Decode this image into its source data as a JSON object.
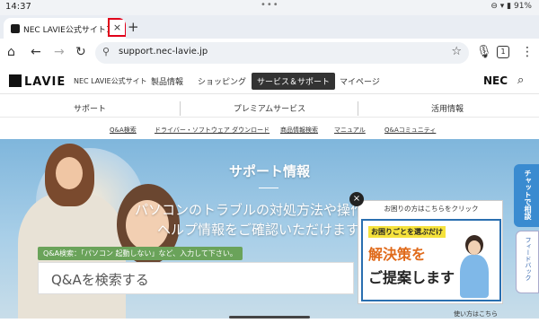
{
  "status_bar": {
    "time": "14:37",
    "battery": "91%"
  },
  "browser": {
    "tab_title": "NEC LAVIE公式サイト＞サ",
    "tab_close_glyph": "×",
    "new_tab_glyph": "+",
    "url": "support.nec-lavie.jp",
    "tab_count": "1"
  },
  "site_header": {
    "logo": "LAVIE",
    "site_name": "NEC LAVIE公式サイト",
    "nav": [
      "製品情報",
      "ショッピング",
      "サービス＆サポート",
      "マイページ"
    ],
    "brand": "NEC"
  },
  "sub_nav": [
    "サポート",
    "プレミアムサービス",
    "活用情報"
  ],
  "sub_nav2": [
    "Q&A検索",
    "ドライバー・ソフトウェア ダウンロード",
    "商品情報検索",
    "マニュアル",
    "Q&Aコミュニティ"
  ],
  "hero": {
    "title": "サポート情報",
    "line1": "パソコンのトラブルの対処方法や操作方",
    "line2": "ヘルプ情報をご確認いただけます"
  },
  "qa_search": {
    "tag": "Q&A検索：「パソコン 起動しない」など、入力して下さい。",
    "placeholder": "Q&Aを検索する",
    "help_link": "使い方はこちら"
  },
  "banner": {
    "header": "お困りの方はこちらをクリック",
    "line1": "お困りごとを選ぶだけ",
    "line2": "解決策を",
    "line3": "ご提案します",
    "close": "×"
  },
  "side_tabs": {
    "chat": "チャットで相談",
    "feedback": "フィードバック"
  }
}
